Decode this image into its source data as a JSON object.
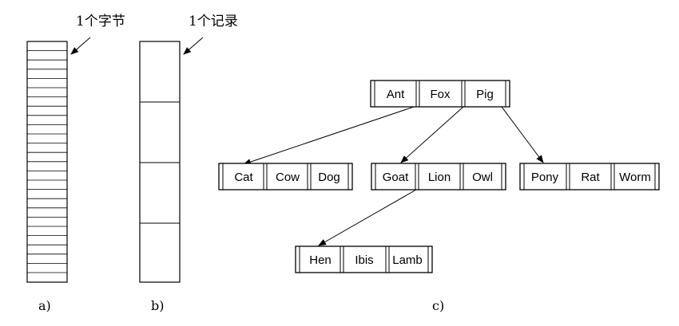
{
  "panel_a": {
    "callout": "1个字节",
    "caption": "a)"
  },
  "panel_b": {
    "callout": "1个记录",
    "caption": "b)"
  },
  "panel_c": {
    "caption": "c)",
    "root": [
      "Ant",
      "Fox",
      "Pig"
    ],
    "children": [
      [
        "Cat",
        "Cow",
        "Dog"
      ],
      [
        "Goat",
        "Lion",
        "Owl"
      ],
      [
        "Pony",
        "Rat",
        "Worm"
      ]
    ],
    "grandchild": [
      "Hen",
      "Ibis",
      "Lamb"
    ]
  }
}
